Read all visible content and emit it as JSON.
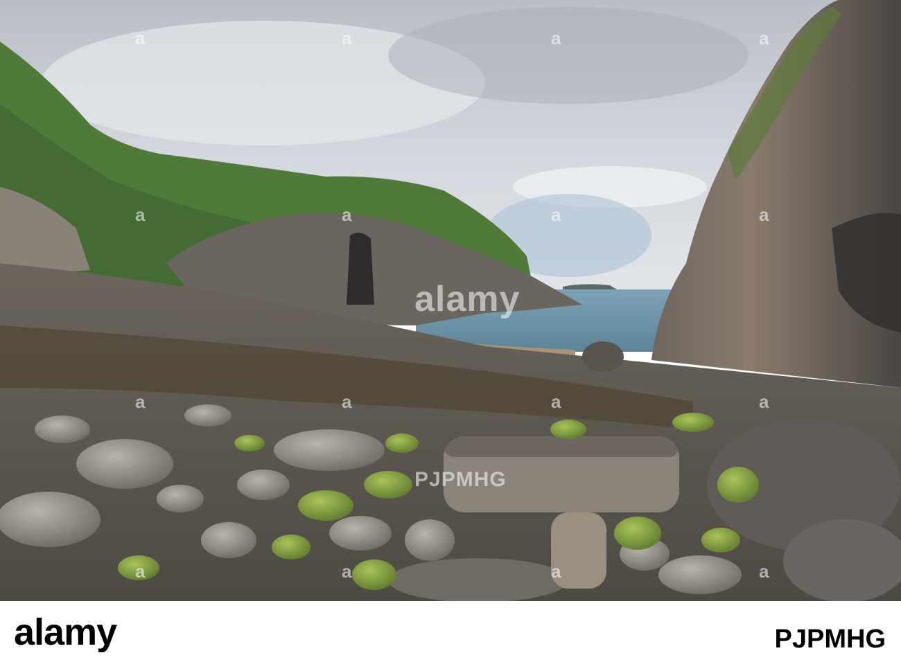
{
  "watermark": {
    "brand": "alamy",
    "image_id": "PJPMHG",
    "repeated_text": "a"
  },
  "footer": {
    "brand": "alamy",
    "image_id": "PJPMHG"
  },
  "colors": {
    "sky": "#c7ccd3",
    "sea": "#6f93a6",
    "grass": "#4f7a3a",
    "cliff_right": "#5a5653",
    "cliff_left": "#6d6660",
    "stones": "#7e7a72",
    "algae": "#8fb33e"
  }
}
